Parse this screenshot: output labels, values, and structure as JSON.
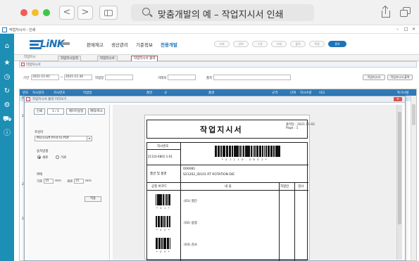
{
  "browser": {
    "url_text": "맞춤개발의 예 – 작업지시서 인쇄",
    "back": "<",
    "forward": ">"
  },
  "app": {
    "title": "작업지시서 - 인쇄",
    "logo_text": "LiNK",
    "menu": [
      "판매재고",
      "생산관리",
      "기준정보",
      "전용개발"
    ],
    "active_menu_index": 3,
    "top_buttons": [
      "조회",
      "입력",
      "수정",
      "삭제",
      "출력",
      "엑셀",
      "종료"
    ],
    "window_controls": [
      "–",
      "□",
      "×"
    ]
  },
  "doc_tabs": {
    "left": "작업지시",
    "tabs": [
      "작업지시입력",
      "작업지시서",
      "작업지시서 출력"
    ],
    "active_index": 2
  },
  "subwin": {
    "title": "작업지시서"
  },
  "filter": {
    "date_label": "기간",
    "date_from": "2021-11-01",
    "date_to": "2021-11-30",
    "workline_label": "작업장",
    "client_label": "거래처",
    "item_label": "품목",
    "btn_search": "작업지시서",
    "btn_print": "작업지시서 출력"
  },
  "grid": {
    "headers": [
      "번호",
      "지시일자",
      "지시번호",
      "작업장",
      "품번",
      "규",
      "품명",
      "규격",
      "단위",
      "지시수량",
      "비고",
      "",
      "",
      "특기사항"
    ],
    "side_rows": [
      "2021-11-02",
      "21-11-02",
      "21-11-02",
      "21-11-02"
    ]
  },
  "dialog": {
    "title": "작업지시서 출력 미리보기",
    "close": "×",
    "option_buttons": [
      "인쇄",
      "1 / 1",
      "페이지설정",
      "확대/축소"
    ],
    "printer_label": "프린터",
    "printer_value": "Microsoft Print to PDF",
    "orientation_label": "용지방향",
    "orientation_portrait": "세로",
    "orientation_landscape": "가로",
    "margin_label": "여백",
    "margin_left_label": "가로",
    "margin_left_value": "15",
    "margin_right_label": "세로",
    "margin_right_value": "15",
    "margin_unit": "mm",
    "apply_label": "적용"
  },
  "paper": {
    "title": "작업지시서",
    "date_label": "출력일 : 2021-11-02",
    "page_label": "Page : 1",
    "order_no_label": "지시번호",
    "order_no_value": "21110-4801-1-01",
    "order_barcode_text": "* 2 1 1 1 0 - 4 8 0 1 *",
    "item_label": "품번 및 품명",
    "item_code": "000081",
    "item_name": "S21202_ID101 RT ROTATION DIE",
    "table_headers": [
      "공정 바코드",
      "내 용",
      "작업인",
      "검사"
    ],
    "process_rows": [
      {
        "code_text": "* 0 1 *",
        "content": "(01) 절단"
      },
      {
        "code_text": "* 0 2 *",
        "content": "(02) 용접"
      },
      {
        "code_text": "* 0 3 *",
        "content": "(03) 검사"
      }
    ]
  },
  "colors": {
    "accent": "#1d8fb5",
    "grid_header": "#2e79b6",
    "close": "#d9534f"
  }
}
